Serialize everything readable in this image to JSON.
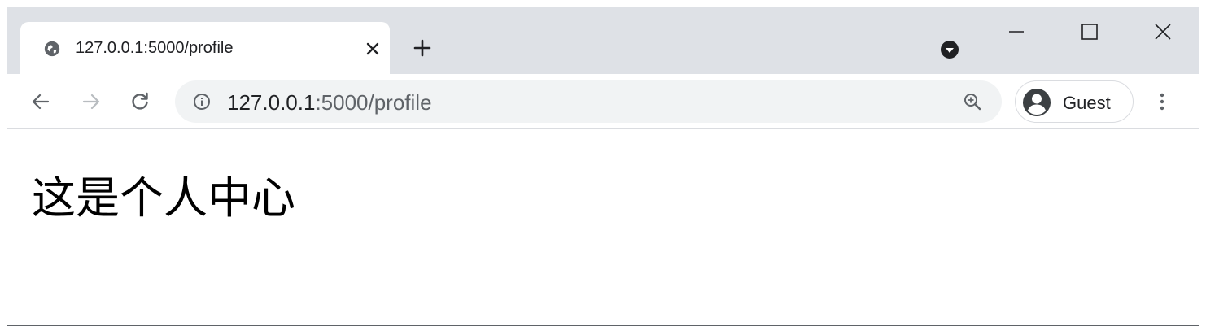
{
  "browser": {
    "tab": {
      "title": "127.0.0.1:5000/profile",
      "favicon": "globe-icon",
      "close": "close-icon"
    },
    "new_tab": "plus-icon",
    "tab_search": "tab-search-icon",
    "window_controls": [
      "minimize-icon",
      "maximize-icon",
      "close-icon"
    ],
    "toolbar": {
      "back": "arrow-left-icon",
      "forward": "arrow-right-icon",
      "reload": "reload-icon",
      "menu": "kebab-menu-icon"
    },
    "omnibox": {
      "icon": "info-icon",
      "url_host": "127.0.0.1",
      "url_rest": ":5000/profile",
      "zoom": "zoom-in-icon"
    },
    "profile": {
      "label": "Guest",
      "icon": "account-circle-icon"
    }
  },
  "page": {
    "heading": "这是个人中心"
  },
  "colors": {
    "tabstrip_bg": "#dee1e6",
    "omnibox_bg": "#f1f3f4",
    "icon": "#5f6368",
    "text": "#202124"
  }
}
